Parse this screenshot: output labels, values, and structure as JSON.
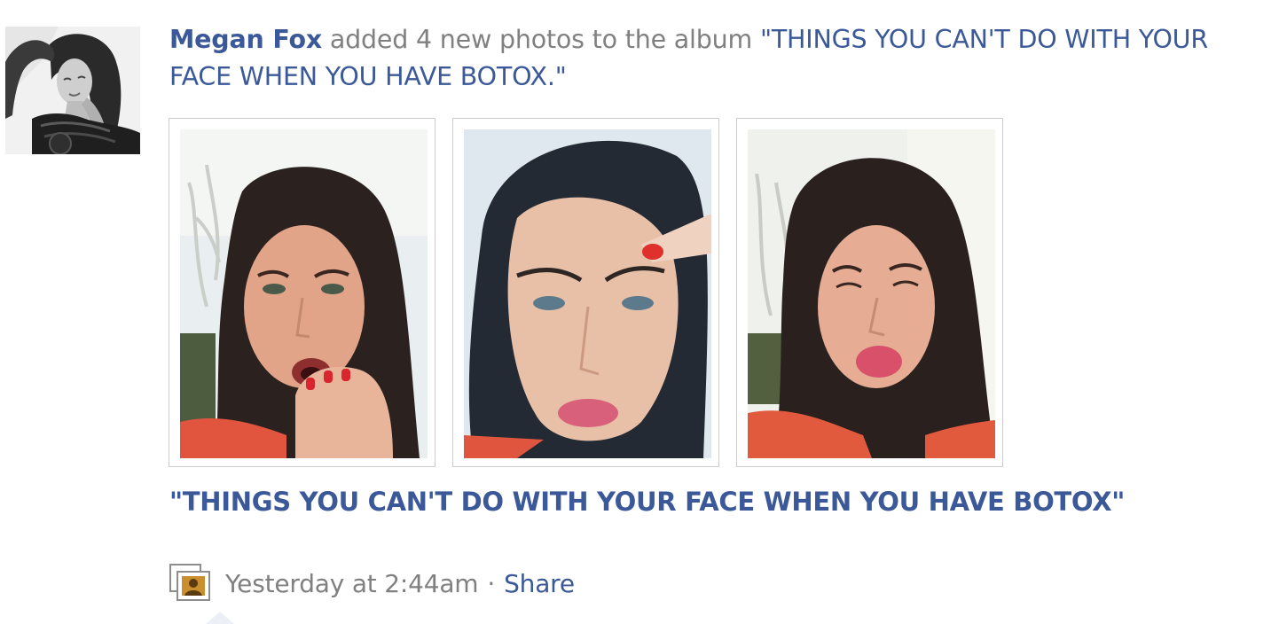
{
  "story": {
    "actor_name": "Megan Fox",
    "action_text": "added 4 new photos to the album",
    "album_link_text": "\"THINGS YOU CAN'T DO WITH YOUR FACE WHEN YOU HAVE BOTOX.\"",
    "album_title": "\"THINGS YOU CAN'T DO WITH YOUR FACE WHEN YOU HAVE BOTOX\"",
    "photos": [
      {
        "name": "photo-1"
      },
      {
        "name": "photo-2"
      },
      {
        "name": "photo-3"
      }
    ],
    "footer": {
      "icon": "photo-album-icon",
      "timestamp": "Yesterday at 2:44am",
      "separator": "·",
      "share_label": "Share"
    }
  },
  "colors": {
    "link": "#3b5998",
    "meta_text": "#808080",
    "thumb_border": "#cccccc"
  }
}
